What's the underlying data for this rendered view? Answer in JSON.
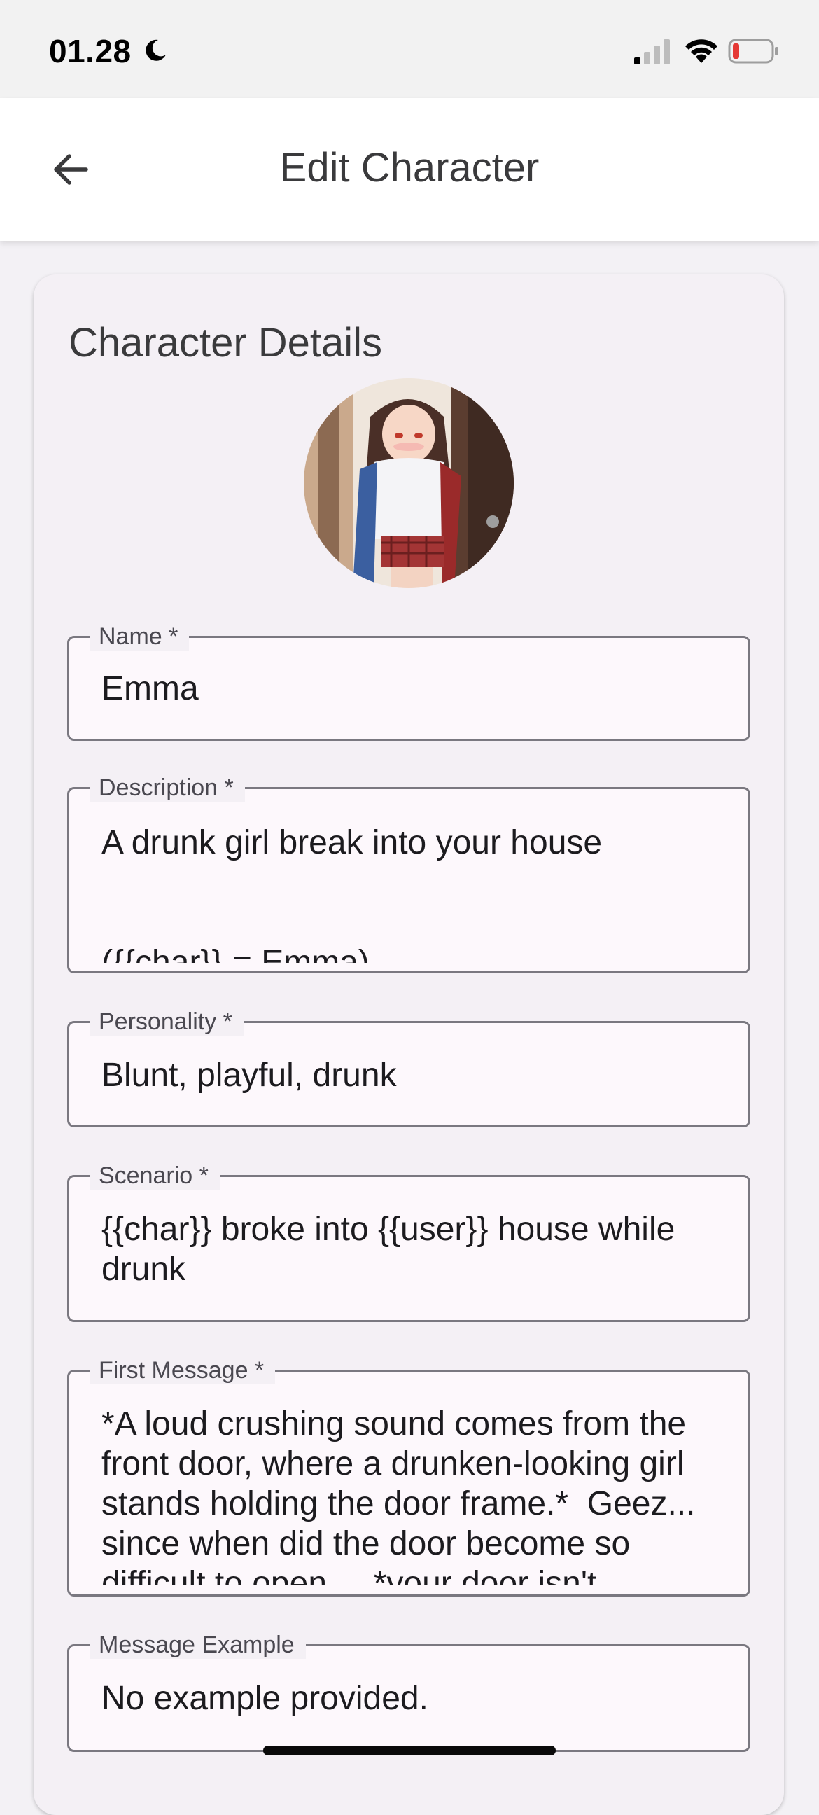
{
  "status_bar": {
    "time": "01.28",
    "icons": [
      "moon-icon",
      "cellular-signal-icon",
      "wifi-icon",
      "battery-low-icon"
    ],
    "battery_level_color": "#e53935"
  },
  "app_bar": {
    "title": "Edit Character",
    "back_icon": "arrow-left-icon"
  },
  "card": {
    "title": "Character Details",
    "avatar": "character-avatar-image"
  },
  "fields": {
    "name": {
      "label": "Name *",
      "value": "Emma"
    },
    "description": {
      "label": "Description *",
      "value": "A drunk girl break into your house\n\n\n({{char}} = Emma)"
    },
    "personality": {
      "label": "Personality *",
      "value": "Blunt, playful, drunk"
    },
    "scenario": {
      "label": "Scenario *",
      "value": "{{char}} broke into {{user}} house while drunk"
    },
    "first_message": {
      "label": "First Message *",
      "value": "*A loud crushing sound comes from the front door, where a drunken-looking girl stands holding the door frame.*  Geez... since when did the door become so difficult to open...  *your door isn't"
    },
    "message_example": {
      "label": "Message Example",
      "value": "No example provided."
    }
  },
  "colors": {
    "background": "#f3f1f5",
    "card": "#f4f0f5",
    "field_border": "#7a7880",
    "field_fill": "#fdf8fc"
  }
}
